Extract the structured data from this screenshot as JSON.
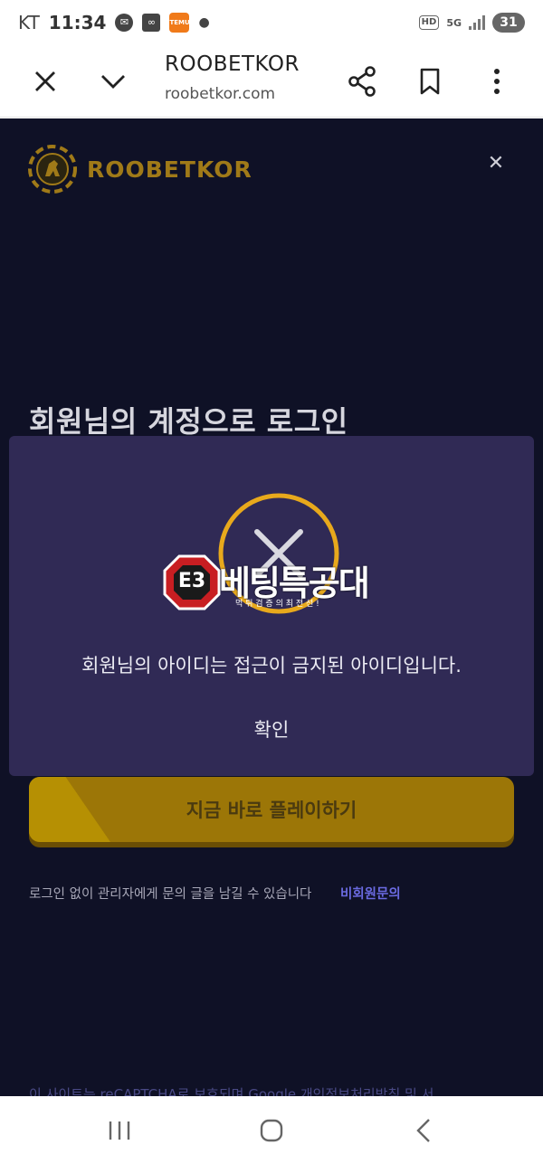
{
  "status_bar": {
    "carrier": "KT",
    "time": "11:34",
    "battery": "31",
    "network": "5G",
    "hd": "HD",
    "notif_icons": [
      "messenger-icon",
      "voicemail-icon",
      "temu-icon"
    ],
    "temu_label": "TEMU"
  },
  "browser": {
    "title": "ROOBETKOR",
    "url": "roobetkor.com"
  },
  "page": {
    "logo_text": "ROOBETKOR",
    "login_heading": "회원님의 계정으로 로그인",
    "play_button": "지금 바로 플레이하기",
    "inquiry_text": "로그인 없이 관리자에게 문의 글을 남길 수 있습니다",
    "inquiry_link": "비회원문의",
    "footer_text": "이 사이트는 reCAPTCHA로 보호되며 Google 개인정보처리방침 및 서"
  },
  "modal": {
    "message": "회원님의 아이디는 접근이 금지된 아이디입니다.",
    "confirm_label": "확인"
  },
  "watermark": {
    "title": "베팅특공대",
    "subtitle": "먹 튀 검 증 의 최 전 선 !",
    "badge_text": "E3"
  },
  "colors": {
    "page_bg": "#0f1126",
    "modal_bg": "#302a55",
    "accent_gold": "#9c7607",
    "circle_gold": "#e8a91c",
    "link": "#6a6ae0"
  }
}
